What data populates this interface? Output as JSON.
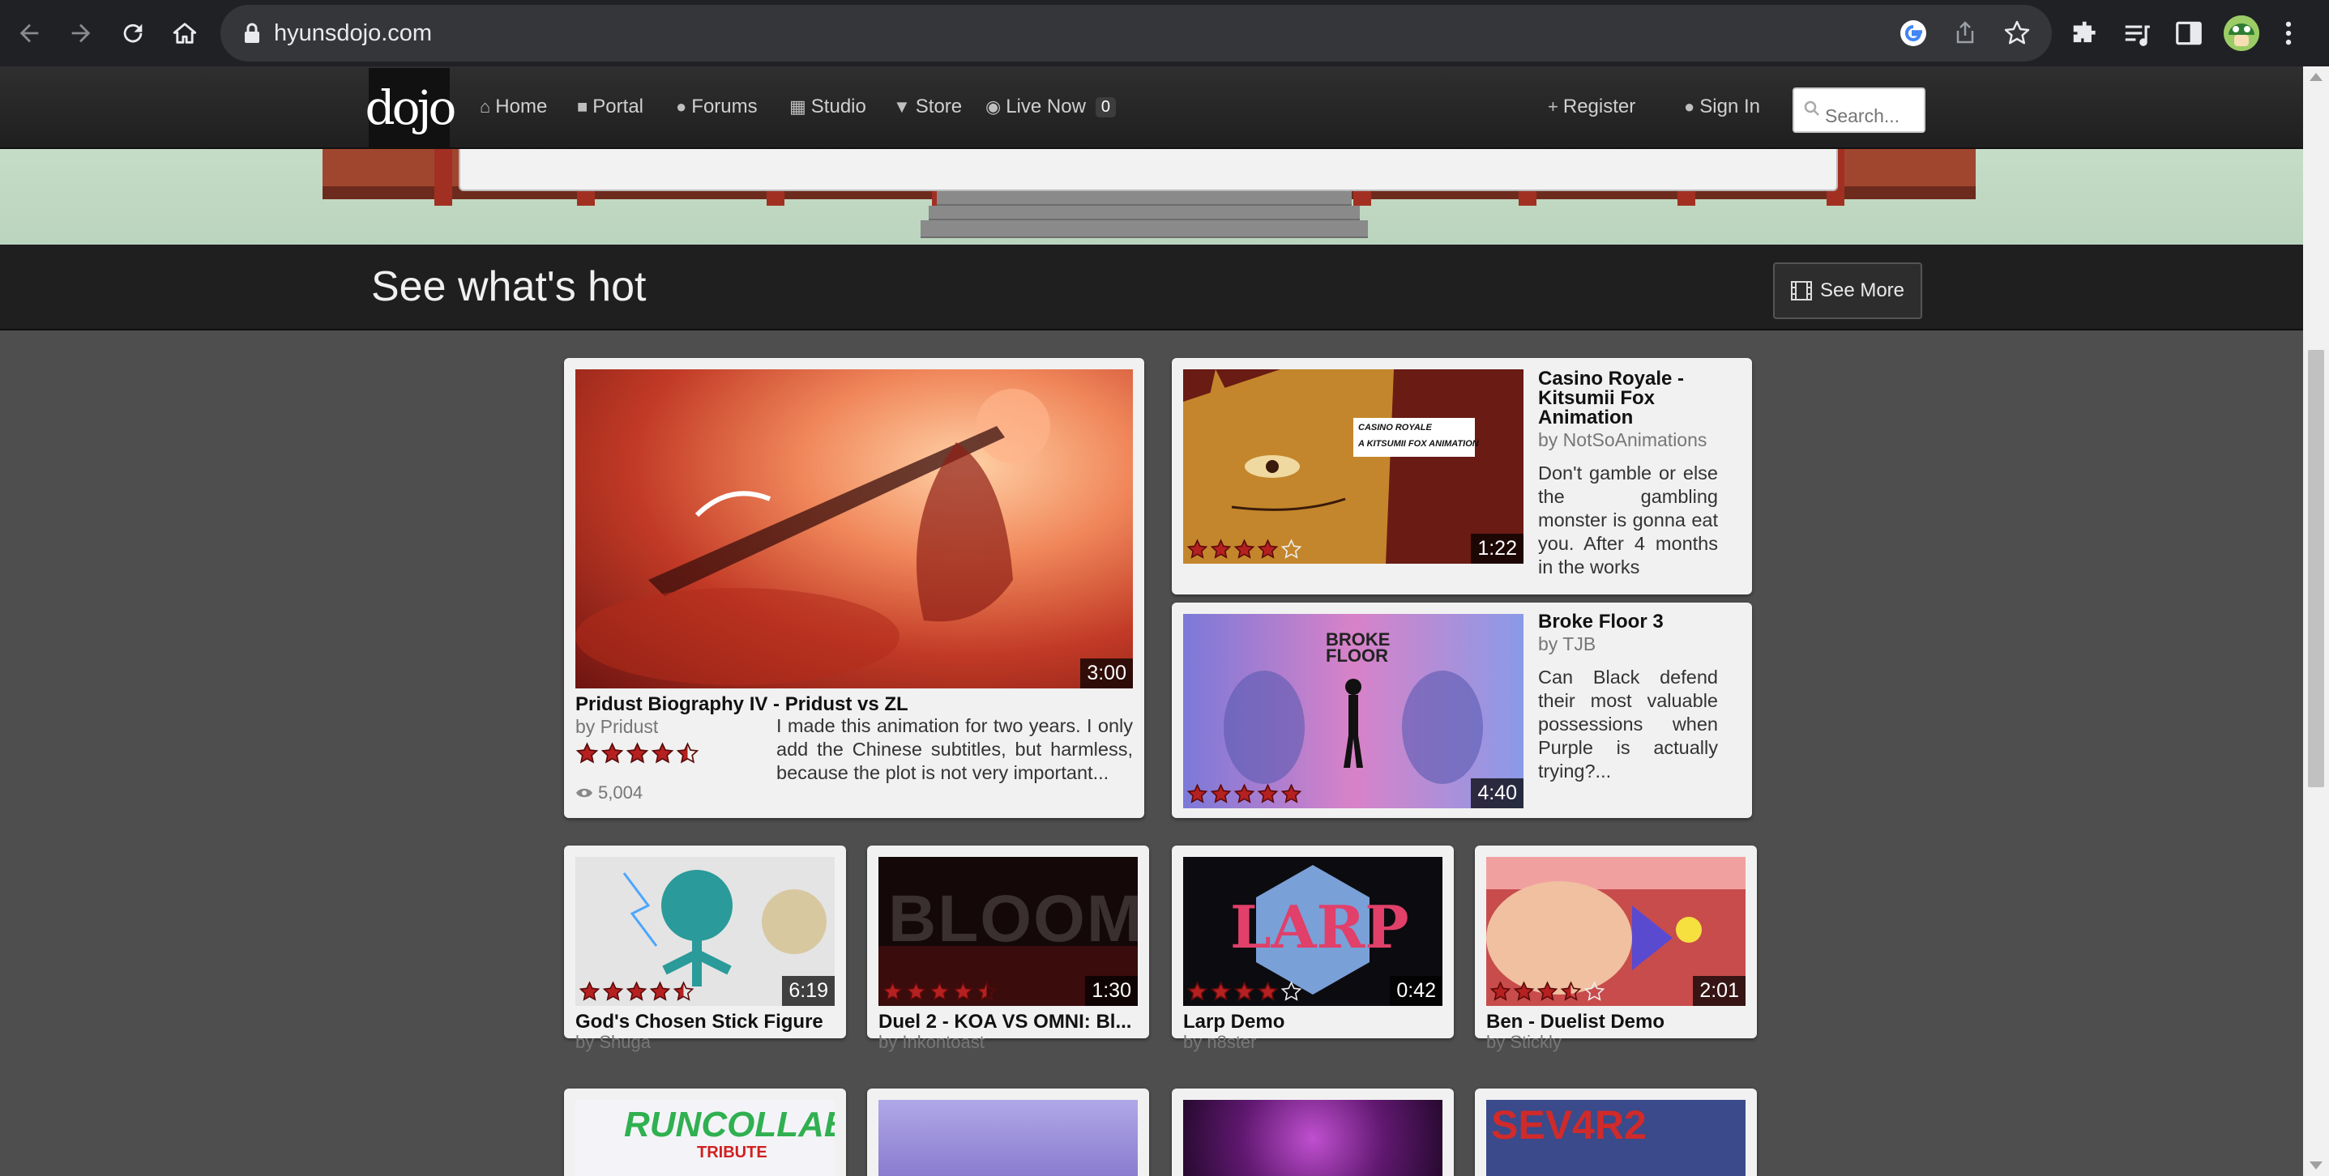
{
  "browser": {
    "url": "hyunsdojo.com"
  },
  "site": {
    "logo_text": "dojo",
    "nav": [
      {
        "label": "Home",
        "icon": "home-icon"
      },
      {
        "label": "Portal",
        "icon": "video-camera-icon"
      },
      {
        "label": "Forums",
        "icon": "comments-icon"
      },
      {
        "label": "Studio",
        "icon": "film-icon"
      },
      {
        "label": "Store",
        "icon": "cart-icon"
      },
      {
        "label": "Live Now",
        "icon": "eye-icon",
        "badge": "0"
      }
    ],
    "register_label": "Register",
    "signin_label": "Sign In",
    "search_placeholder": "Search..."
  },
  "hot": {
    "title": "See what's hot",
    "see_more_label": "See More"
  },
  "featured": {
    "title": "Pridust Biography IV - Pridust vs ZL",
    "author": "by Pridust",
    "duration": "3:00",
    "rating": 4.5,
    "views": "5,004",
    "description": "I made this animation for two years. I only add the Chinese subtitles, but harmless, because the plot is not very important..."
  },
  "side_videos": [
    {
      "title": "Casino Royale - Kitsumii Fox Animation",
      "author": "by NotSoAnimations",
      "duration": "1:22",
      "rating": 4.0,
      "description": "Don't gamble or else the gambling monster is gonna eat you. After 4 months in the works",
      "thumb_caption_1": "CASINO ROYALE",
      "thumb_caption_2": "A KITSUMII FOX ANIMATION"
    },
    {
      "title": "Broke Floor 3",
      "author": "by TJB",
      "duration": "4:40",
      "rating": 5.0,
      "description": "Can Black defend their most valuable possessions when Purple is actually trying?...",
      "thumb_caption_1": "BROKE",
      "thumb_caption_2": "FLOOR"
    }
  ],
  "grid_videos": [
    {
      "title": "God's Chosen Stick Figure",
      "author": "by Shuga",
      "duration": "6:19",
      "rating": 4.5
    },
    {
      "title": "Duel 2 - KOA VS OMNI: Bl...",
      "author": "by Inkontoast",
      "duration": "1:30",
      "rating": 4.5,
      "thumb_text": "BLOOM"
    },
    {
      "title": "Larp Demo",
      "author": "by n8ster",
      "duration": "0:42",
      "rating": 4.0,
      "thumb_text": "LARP"
    },
    {
      "title": "Ben - Duelist Demo",
      "author": "by Stickly",
      "duration": "2:01",
      "rating": 3.5
    }
  ],
  "bottom_thumbs": [
    {
      "text": "RUNCOLLAB",
      "subtext": "TRIBUTE"
    },
    {
      "text": ""
    },
    {
      "text": ""
    },
    {
      "text": "SEV4R2"
    }
  ],
  "colors": {
    "star": "#b52020",
    "header_bg": "#2a2a2a",
    "page_bg": "#4e4e4e",
    "card_bg": "#f1f1f1"
  }
}
